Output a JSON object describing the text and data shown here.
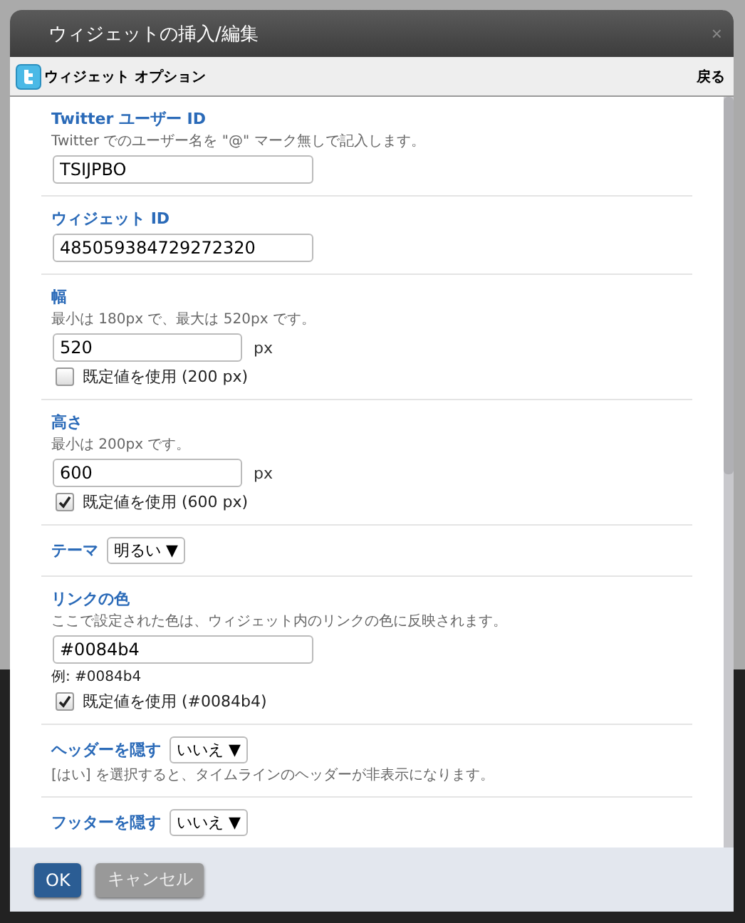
{
  "dialog": {
    "title": "ウィジェットの挿入/編集",
    "close": "×"
  },
  "subheader": {
    "title": "ウィジェット オプション",
    "back": "戻る"
  },
  "sections": [
    {
      "kind": "text",
      "label": "Twitter ユーザー ID",
      "hint": "Twitter でのユーザー名を \"@\" マーク無しで記入します。",
      "value": "TSIJPBO"
    },
    {
      "kind": "text",
      "label": "ウィジェット ID",
      "value": "485059384729272320"
    },
    {
      "kind": "number",
      "label": "幅",
      "hint": "最小は 180px で、最大は 520px です。",
      "value": "520",
      "unit": "px",
      "default_label": "既定値を使用 (200 px)",
      "checked": false
    },
    {
      "kind": "number",
      "label": "高さ",
      "hint": "最小は 200px です。",
      "value": "600",
      "unit": "px",
      "default_label": "既定値を使用 (600 px)",
      "checked": true
    },
    {
      "kind": "select",
      "label": "テーマ",
      "value": "明るい ▼"
    },
    {
      "kind": "color",
      "label": "リンクの色",
      "hint": "ここで設定された色は、ウィジェット内のリンクの色に反映されます。",
      "value": "#0084b4",
      "example": "例: #0084b4",
      "default_label": "既定値を使用 (#0084b4)",
      "checked": true
    },
    {
      "kind": "select",
      "label": "ヘッダーを隠す",
      "value": "いいえ ▼",
      "hint": "[はい] を選択すると、タイムラインのヘッダーが非表示になります。"
    },
    {
      "kind": "select",
      "label": "フッターを隠す",
      "value": "いいえ ▼"
    }
  ],
  "buttons": [
    {
      "label": "OK",
      "kind": "primary"
    },
    {
      "label": "キャンセル",
      "kind": "secondary"
    }
  ]
}
